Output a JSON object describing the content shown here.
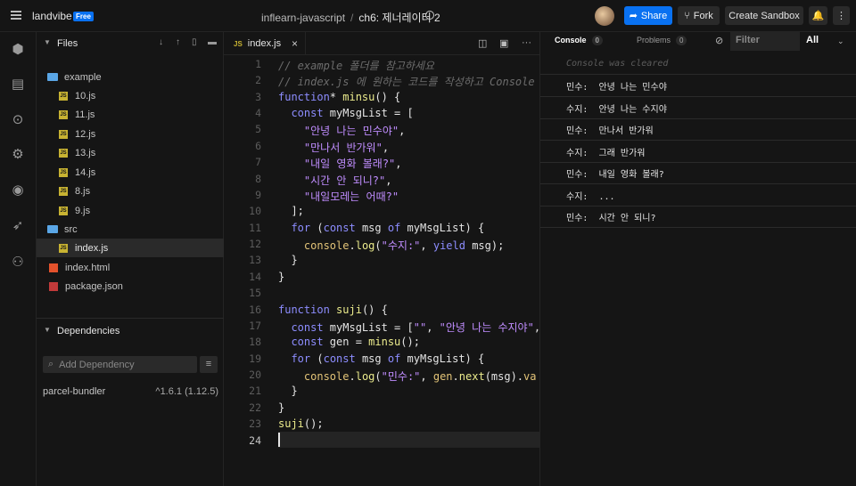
{
  "topbar": {
    "brand": "landvibe",
    "badge": "Free",
    "workspace": "inflearn-javascript",
    "separator": "/",
    "sandbox_name": "ch6: 제너레이터 2",
    "share_label": "Share",
    "fork_label": "Fork",
    "create_label": "Create Sandbox"
  },
  "files": {
    "title": "Files",
    "tree": [
      {
        "type": "folder",
        "label": "example"
      },
      {
        "type": "js",
        "label": "10.js"
      },
      {
        "type": "js",
        "label": "11.js"
      },
      {
        "type": "js",
        "label": "12.js"
      },
      {
        "type": "js",
        "label": "13.js"
      },
      {
        "type": "js",
        "label": "14.js"
      },
      {
        "type": "js",
        "label": "8.js"
      },
      {
        "type": "js",
        "label": "9.js"
      },
      {
        "type": "folder",
        "label": "src"
      },
      {
        "type": "js",
        "label": "index.js",
        "active": true
      },
      {
        "type": "html",
        "label": "index.html"
      },
      {
        "type": "npm",
        "label": "package.json"
      }
    ]
  },
  "dependencies": {
    "title": "Dependencies",
    "placeholder": "Add Dependency",
    "items": [
      {
        "name": "parcel-bundler",
        "version": "^1.6.1 (1.12.5)"
      }
    ]
  },
  "editor": {
    "tab_icon": "JS",
    "tab_label": "index.js",
    "tab_close": "×",
    "line_numbers": [
      "1",
      "2",
      "3",
      "4",
      "5",
      "6",
      "7",
      "8",
      "9",
      "10",
      "11",
      "12",
      "13",
      "14",
      "15",
      "16",
      "17",
      "18",
      "19",
      "20",
      "21",
      "22",
      "23",
      "24"
    ]
  },
  "console": {
    "tab_console": "Console",
    "tab_console_count": "0",
    "tab_problems": "Problems",
    "tab_problems_count": "0",
    "filter_placeholder": "Filter",
    "level": "All",
    "cleared": "Console was cleared",
    "logs": [
      "민수:  안녕 나는 민수야",
      "수지:  안녕 나는 수지야",
      "민수:  만나서 반가워",
      "수지:  그래 반가워",
      "민수:  내일 영화 볼래?",
      "수지:  ...",
      "민수:  시간 안 되니?"
    ]
  },
  "icons": {
    "rail": [
      "sandbox-icon",
      "file-icon",
      "search-icon",
      "gear-icon",
      "github-icon",
      "deploy-rocket-icon",
      "team-icon"
    ]
  }
}
